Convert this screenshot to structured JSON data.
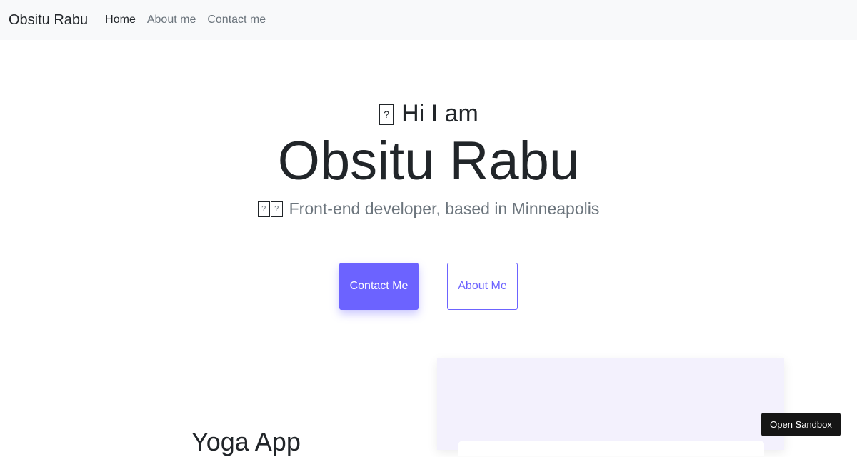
{
  "navbar": {
    "brand": "Obsitu Rabu",
    "links": [
      {
        "label": "Home"
      },
      {
        "label": "About me"
      },
      {
        "label": "Contact me"
      }
    ]
  },
  "hero": {
    "greeting": "Hi I am",
    "greeting_icon": "missing-emoji-glyph",
    "name": "Obsitu Rabu",
    "tagline": "Front-end developer, based in Minneapolis",
    "tagline_icons": [
      "missing-emoji-glyph",
      "missing-emoji-glyph"
    ],
    "contact_button": "Contact Me",
    "about_button": "About Me"
  },
  "project": {
    "title": "Yoga App"
  },
  "sandbox": {
    "label": "Open Sandbox"
  },
  "colors": {
    "accent": "#6c63ff",
    "navbar_bg": "#f8f9fa",
    "card_bg": "#f3f1fd",
    "sandbox_bg": "#151515"
  }
}
